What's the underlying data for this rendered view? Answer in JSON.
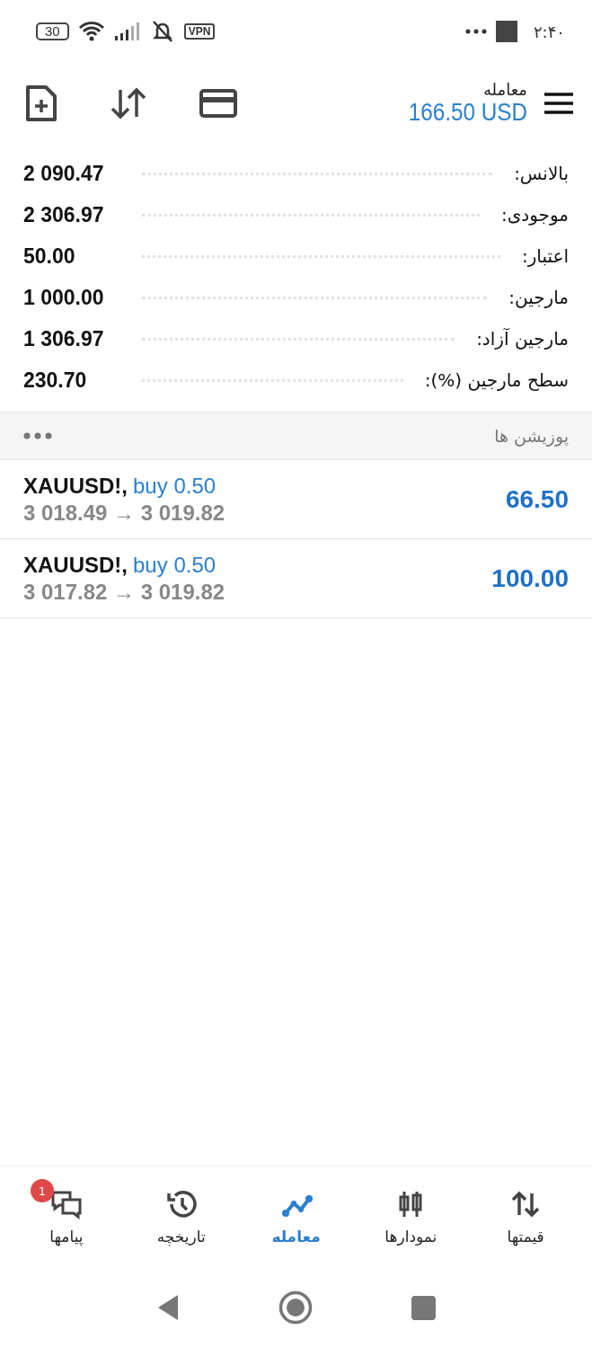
{
  "status_bar": {
    "time": "۲:۴۰",
    "battery": "30",
    "vpn": "VPN"
  },
  "header": {
    "title": "معامله",
    "amount": "166.50 USD"
  },
  "summary": [
    {
      "label": "بالانس:",
      "value": "2 090.47"
    },
    {
      "label": "موجودی:",
      "value": "2 306.97"
    },
    {
      "label": "اعتبار:",
      "value": "50.00"
    },
    {
      "label": "مارجین:",
      "value": "1 000.00"
    },
    {
      "label": "مارجین آزاد:",
      "value": "1 306.97"
    },
    {
      "label": "سطح مارجین (%):",
      "value": "230.70"
    }
  ],
  "positions": {
    "title": "پوزیشن ها",
    "items": [
      {
        "symbol": "XAUUSD!,",
        "side": "buy 0.50",
        "prices": "3 018.49 → 3 019.82",
        "profit": "66.50"
      },
      {
        "symbol": "XAUUSD!,",
        "side": "buy 0.50",
        "prices": "3 017.82 → 3 019.82",
        "profit": "100.00"
      }
    ]
  },
  "tabs": [
    {
      "kind": "quotes",
      "label": "قیمتها",
      "selected": false
    },
    {
      "kind": "charts",
      "label": "نمودارها",
      "selected": false
    },
    {
      "kind": "trade",
      "label": "معامله",
      "selected": true
    },
    {
      "kind": "history",
      "label": "تاریخچه",
      "selected": false
    },
    {
      "kind": "messages",
      "label": "پیامها",
      "selected": false,
      "badge": "1"
    }
  ]
}
